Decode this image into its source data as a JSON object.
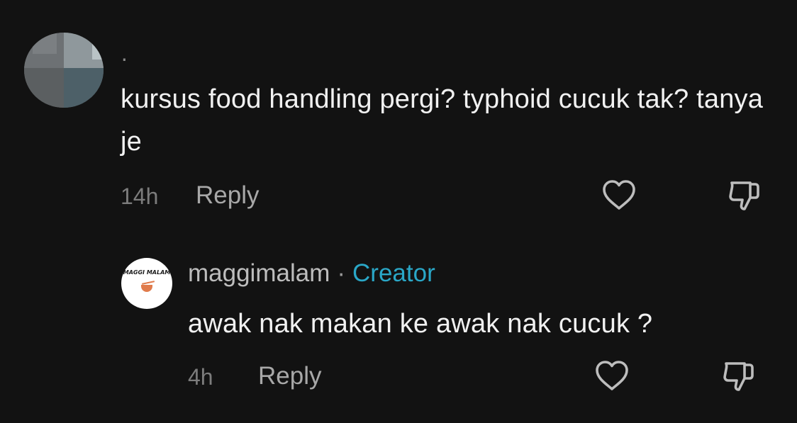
{
  "comments": [
    {
      "username": "·",
      "text": "kursus food handling pergi? typhoid cucuk tak? tanya je",
      "time": "14h",
      "reply_label": "Reply",
      "like_icon": "heart-outline-icon",
      "dislike_icon": "thumbs-down-icon"
    }
  ],
  "reply": {
    "username": "maggimalam",
    "separator": "·",
    "badge": "Creator",
    "avatar_logo": "MAGGI MALAM",
    "text": "awak nak makan ke awak nak cucuk ?",
    "time": "4h",
    "reply_label": "Reply",
    "like_icon": "heart-outline-icon",
    "dislike_icon": "thumbs-down-icon"
  },
  "colors": {
    "background": "#121212",
    "text": "#f1f1f1",
    "muted": "#7c7c7c",
    "creator_badge": "#2aa7c7"
  }
}
